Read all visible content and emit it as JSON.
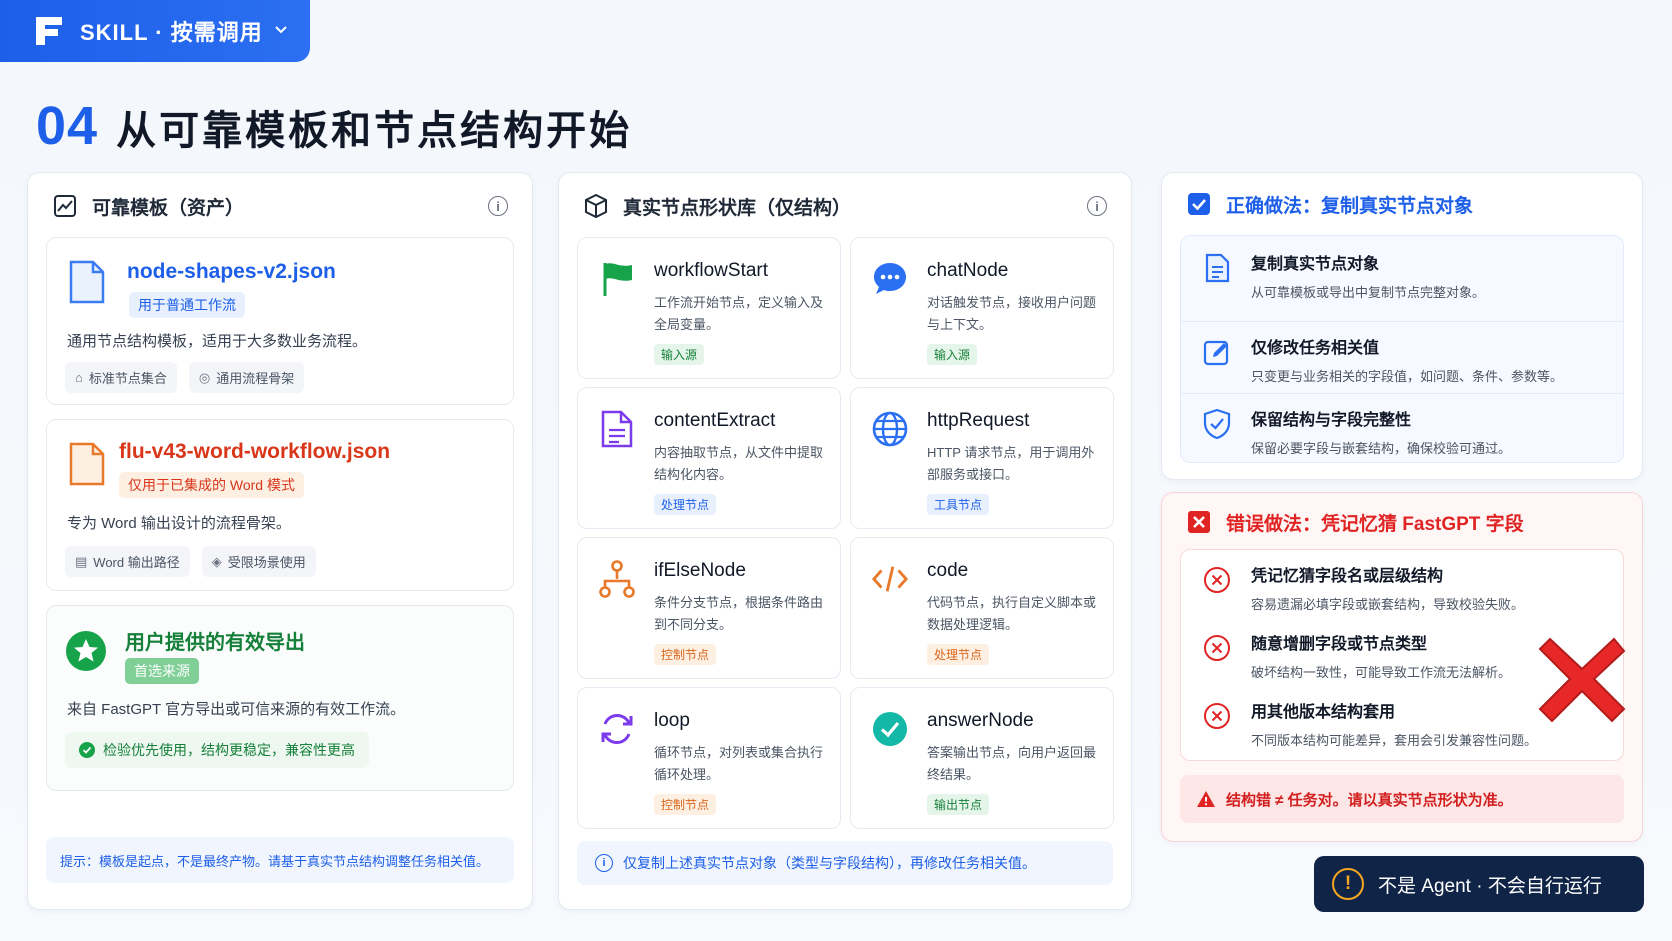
{
  "topbar": {
    "label": "SKILL · 按需调用"
  },
  "page": {
    "number": "04",
    "title": "从可靠模板和节点结构开始"
  },
  "left_panel": {
    "title": "可靠模板（资产）",
    "card1": {
      "filename": "node-shapes-v2.json",
      "tag": "用于普通工作流",
      "desc": "通用节点结构模板，适用于大多数业务流程。",
      "chips": [
        "标准节点集合",
        "通用流程骨架"
      ]
    },
    "card2": {
      "filename": "flu-v43-word-workflow.json",
      "tag": "仅用于已集成的 Word 模式",
      "desc": "专为 Word 输出设计的流程骨架。",
      "chips": [
        "Word 输出路径",
        "受限场景使用"
      ]
    },
    "card3": {
      "title": "用户提供的有效导出",
      "tag": "首选来源",
      "desc": "来自 FastGPT 官方导出或可信来源的有效工作流。",
      "note": "检验优先使用，结构更稳定，兼容性更高"
    },
    "hint": "提示：模板是起点，不是最终产物。请基于真实节点结构调整任务相关值。"
  },
  "mid_panel": {
    "title": "真实节点形状库（仅结构）",
    "nodes": [
      {
        "name": "workflowStart",
        "desc": "工作流开始节点，定义输入及全局变量。",
        "tag": "输入源",
        "icon": "flag-icon"
      },
      {
        "name": "chatNode",
        "desc": "对话触发节点，接收用户问题与上下文。",
        "tag": "输入源",
        "icon": "chat-icon"
      },
      {
        "name": "contentExtract",
        "desc": "内容抽取节点，从文件中提取结构化内容。",
        "tag": "处理节点",
        "icon": "document-icon"
      },
      {
        "name": "httpRequest",
        "desc": "HTTP 请求节点，用于调用外部服务或接口。",
        "tag": "工具节点",
        "icon": "globe-icon"
      },
      {
        "name": "ifElseNode",
        "desc": "条件分支节点，根据条件路由到不同分支。",
        "tag": "控制节点",
        "icon": "branch-icon"
      },
      {
        "name": "code",
        "desc": "代码节点，执行自定义脚本或数据处理逻辑。",
        "tag": "处理节点",
        "icon": "code-icon"
      },
      {
        "name": "loop",
        "desc": "循环节点，对列表或集合执行循环处理。",
        "tag": "控制节点",
        "icon": "loop-icon"
      },
      {
        "name": "answerNode",
        "desc": "答案输出节点，向用户返回最终结果。",
        "tag": "输出节点",
        "icon": "check-circle-icon"
      }
    ],
    "footer": "仅复制上述真实节点对象（类型与字段结构），再修改任务相关值。"
  },
  "right_top": {
    "title": "正确做法：复制真实节点对象",
    "items": [
      {
        "title": "复制真实节点对象",
        "desc": "从可靠模板或导出中复制节点完整对象。"
      },
      {
        "title": "仅修改任务相关值",
        "desc": "只变更与业务相关的字段值，如问题、条件、参数等。"
      },
      {
        "title": "保留结构与字段完整性",
        "desc": "保留必要字段与嵌套结构，确保校验可通过。"
      }
    ]
  },
  "right_bottom": {
    "title": "错误做法：凭记忆猜 FastGPT 字段",
    "items": [
      {
        "title": "凭记忆猜字段名或层级结构",
        "desc": "容易遗漏必填字段或嵌套结构，导致校验失败。"
      },
      {
        "title": "随意增删字段或节点类型",
        "desc": "破坏结构一致性，可能导致工作流无法解析。"
      },
      {
        "title": "用其他版本结构套用",
        "desc": "不同版本结构可能差异，套用会引发兼容性问题。"
      }
    ],
    "warning": "结构错 ≠ 任务对。请以真实节点形状为准。"
  },
  "badge": {
    "text": "不是 Agent · 不会自行运行"
  },
  "colors": {
    "primary": "#1d5fe8",
    "danger": "#e02424",
    "success": "#16a34a",
    "orange": "#e8792a"
  }
}
